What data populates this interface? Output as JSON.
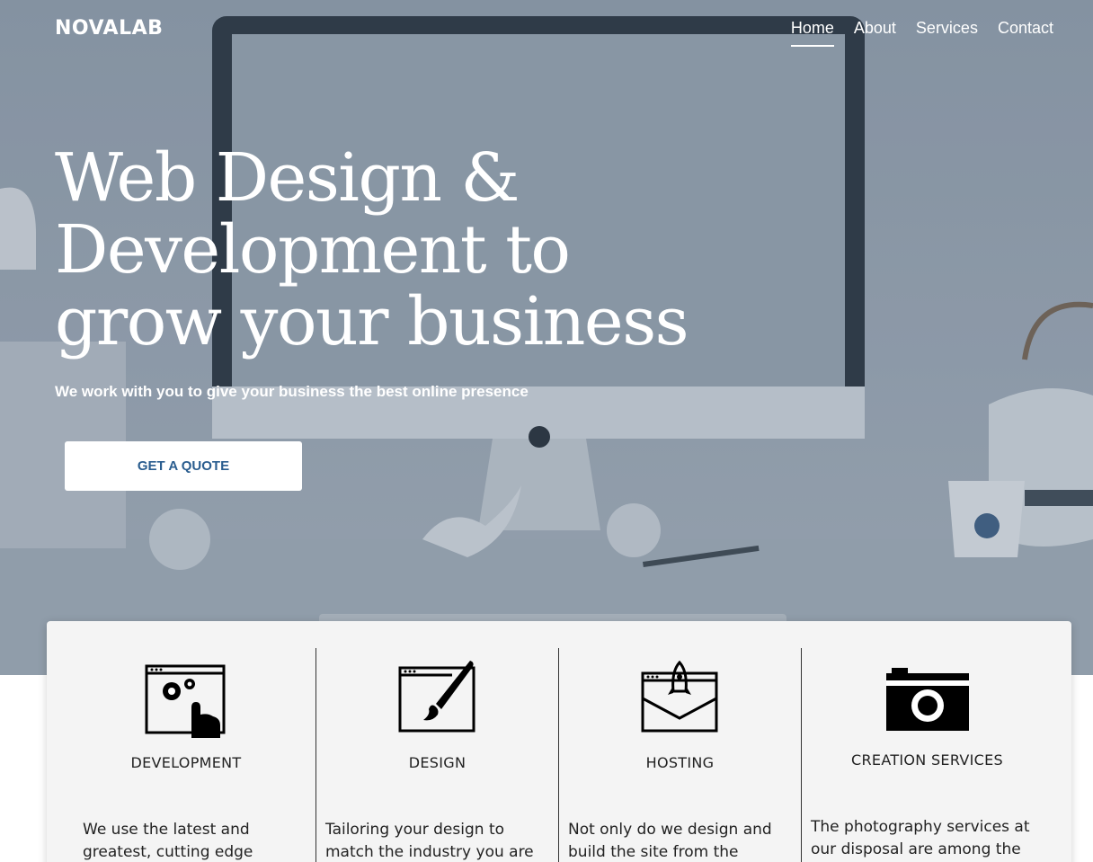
{
  "header": {
    "logo": "NOVALAB",
    "nav": [
      {
        "label": "Home"
      },
      {
        "label": "About"
      },
      {
        "label": "Services"
      },
      {
        "label": "Contact"
      }
    ]
  },
  "hero": {
    "headline": "Web Design & Development to grow your business",
    "subheadline": "We work with you to give your business the best online presence",
    "cta_label": "GET A QUOTE"
  },
  "services": [
    {
      "title": "DEVELOPMENT",
      "text": "We use the latest and greatest, cutting edge",
      "icon": "code-gears-icon"
    },
    {
      "title": "DESIGN",
      "text": "Tailoring your design to match the industry you are in",
      "icon": "paintbrush-icon"
    },
    {
      "title": "HOSTING",
      "text": "Not only do we design and build the site from the ground",
      "icon": "rocket-envelope-icon"
    },
    {
      "title": "CREATION SERVICES",
      "text": "The photography services at our disposal are among the",
      "icon": "camera-icon"
    }
  ],
  "colors": {
    "accent": "#2a5d8f",
    "hero_tint": "#8e9aa8",
    "card_bg": "#f4f4f4"
  }
}
